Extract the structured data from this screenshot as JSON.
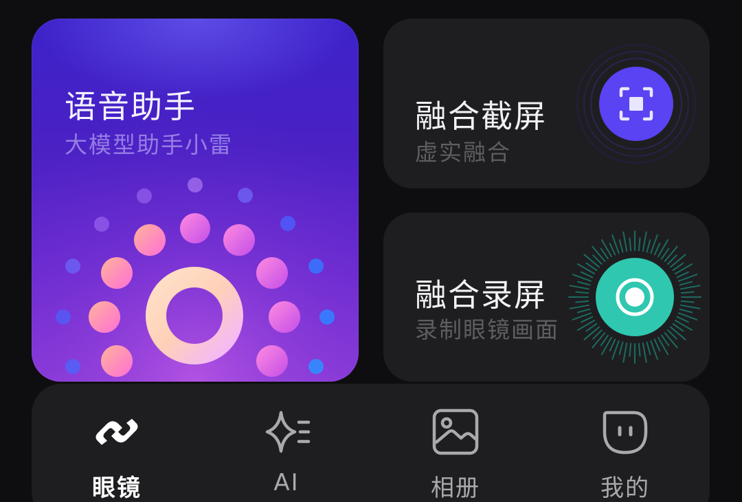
{
  "cards": {
    "voice": {
      "title": "语音助手",
      "subtitle": "大模型助手小雷",
      "icon": "voice-orb-icon"
    },
    "screenshot": {
      "title": "融合截屏",
      "subtitle": "虚实融合",
      "icon": "screenshot-frame-icon",
      "accent": "#5a43f2"
    },
    "record": {
      "title": "融合录屏",
      "subtitle": "录制眼镜画面",
      "icon": "record-icon",
      "accent": "#2fc7b0"
    }
  },
  "nav": {
    "items": [
      {
        "label": "眼镜",
        "icon": "glasses-link-icon",
        "active": true
      },
      {
        "label": "AI",
        "icon": "ai-sparkle-icon",
        "active": false
      },
      {
        "label": "相册",
        "icon": "album-image-icon",
        "active": false
      },
      {
        "label": "我的",
        "icon": "profile-face-icon",
        "active": false
      }
    ]
  }
}
